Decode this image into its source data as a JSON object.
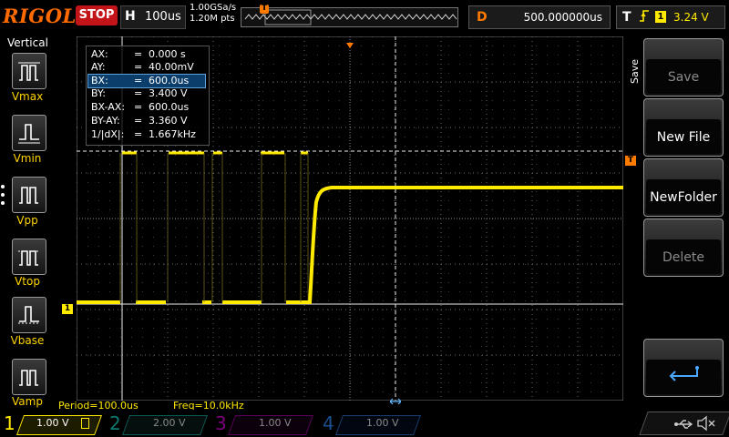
{
  "topbar": {
    "brand": "RIGOL",
    "run_state": "STOP",
    "timebase_letter": "H",
    "timebase": "100us",
    "sample_rate": "1.00GSa/s",
    "points": "1.20M pts",
    "trigger_marker": "T",
    "delay_letter": "D",
    "delay": "500.000000us",
    "trigger_letter": "T",
    "trigger_edge": "rising-edge-icon",
    "trigger_source": "1",
    "trigger_level": "3.24 V"
  },
  "left_menu": {
    "title": "Vertical",
    "items": [
      {
        "label": "Vmax",
        "icon": "vmax-icon"
      },
      {
        "label": "Vmin",
        "icon": "vmin-icon"
      },
      {
        "label": "Vpp",
        "icon": "vpp-icon"
      },
      {
        "label": "Vtop",
        "icon": "vtop-icon"
      },
      {
        "label": "Vbase",
        "icon": "vbase-icon"
      },
      {
        "label": "Vamp",
        "icon": "vamp-icon"
      }
    ]
  },
  "cursor": {
    "rows": [
      {
        "key": "AX:",
        "value": "0.000 s"
      },
      {
        "key": "AY:",
        "value": "40.00mV"
      },
      {
        "key": "BX:",
        "value": "600.0us",
        "selected": true
      },
      {
        "key": "BY:",
        "value": "3.400 V"
      },
      {
        "key": "BX-AX:",
        "value": "600.0us"
      },
      {
        "key": "BY-AY:",
        "value": "3.360 V"
      },
      {
        "key": "1/|dX|:",
        "value": "1.667kHz"
      }
    ]
  },
  "markers": {
    "channel_ground": "1",
    "trigger_level_marker": "T"
  },
  "measurements": {
    "period": "Period=100.0us",
    "freq": "Freq=10.0kHz"
  },
  "right_menu": {
    "title": "Save",
    "buttons": [
      {
        "label": "Save",
        "enabled": false
      },
      {
        "label": "New File",
        "enabled": true
      },
      {
        "label": "NewFolder",
        "enabled": true
      },
      {
        "label": "Delete",
        "enabled": false
      },
      {
        "label": "",
        "icon": "enter-arrow-icon",
        "enabled": true
      }
    ]
  },
  "channels": [
    {
      "num": "1",
      "scale": "1.00 V",
      "color": "#ffea00",
      "active": true
    },
    {
      "num": "2",
      "scale": "2.00 V",
      "color": "#00b7a8",
      "active": false
    },
    {
      "num": "3",
      "scale": "1.00 V",
      "color": "#c000c0",
      "active": false
    },
    {
      "num": "4",
      "scale": "1.00 V",
      "color": "#1e6fd0",
      "active": false
    }
  ],
  "status_icons": [
    "usb-icon",
    "speaker-muted-icon"
  ],
  "colors": {
    "ch1": "#ffea00",
    "accent": "#ff7a00",
    "stop": "#c3141a"
  }
}
